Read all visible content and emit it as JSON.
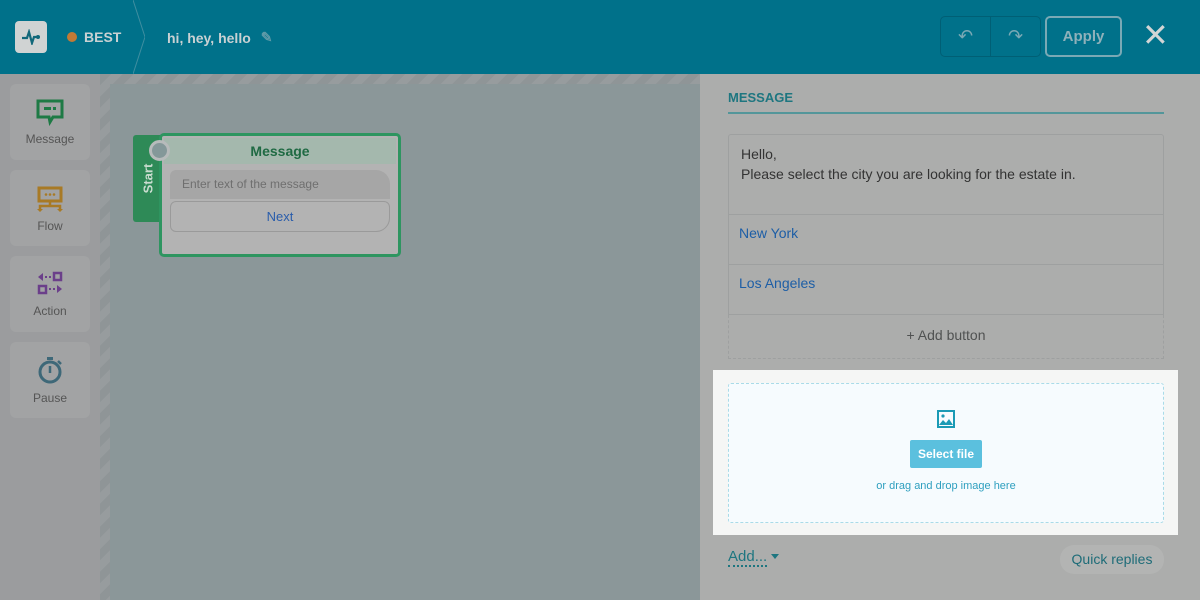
{
  "header": {
    "status": "BEST",
    "status_color": "#c27a35",
    "flow_title": "hi, hey, hello",
    "apply_label": "Apply"
  },
  "sidebar": {
    "items": [
      {
        "label": "Message",
        "icon": "message-icon"
      },
      {
        "label": "Flow",
        "icon": "flow-icon"
      },
      {
        "label": "Action",
        "icon": "action-icon"
      },
      {
        "label": "Pause",
        "icon": "stopwatch-icon"
      }
    ]
  },
  "canvas": {
    "start_label": "Start",
    "node": {
      "title": "Message",
      "placeholder": "Enter text of the message",
      "button": "Next"
    }
  },
  "panel": {
    "section_title": "MESSAGE",
    "message_text": "Hello,\nPlease select the city you are looking for the estate in.",
    "buttons": [
      "New York",
      "Los Angeles"
    ],
    "add_button_label": "+ Add button",
    "upload": {
      "select_label": "Select file",
      "hint": "or drag and drop image here"
    },
    "add_label": "Add...",
    "quick_replies_label": "Quick replies"
  }
}
